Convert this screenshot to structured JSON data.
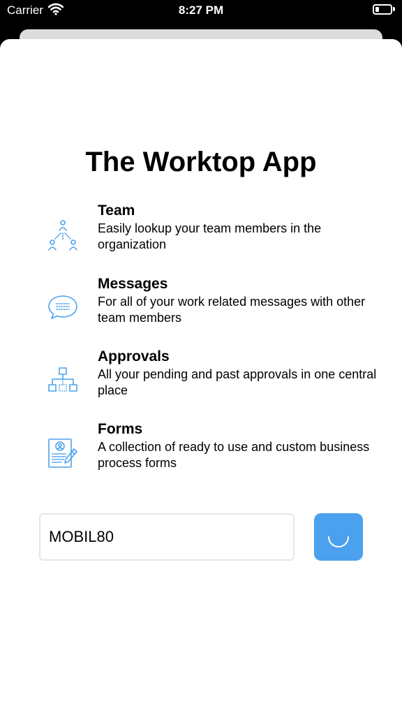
{
  "status_bar": {
    "carrier": "Carrier",
    "time": "8:27 PM"
  },
  "app": {
    "title": "The Worktop App"
  },
  "features": [
    {
      "icon": "team-icon",
      "heading": "Team",
      "description": "Easily lookup your team members in the organization"
    },
    {
      "icon": "messages-icon",
      "heading": "Messages",
      "description": "For all of your work related messages with other team members"
    },
    {
      "icon": "approvals-icon",
      "heading": "Approvals",
      "description": "All your pending and past approvals in one central place"
    },
    {
      "icon": "forms-icon",
      "heading": "Forms",
      "description": "A collection of ready to use and custom business process forms"
    }
  ],
  "login": {
    "code_value": "MOBIL80",
    "button_state": "loading"
  },
  "colors": {
    "accent": "#4ba1ee",
    "icon": "#4ba1ee",
    "background": "#ffffff"
  }
}
